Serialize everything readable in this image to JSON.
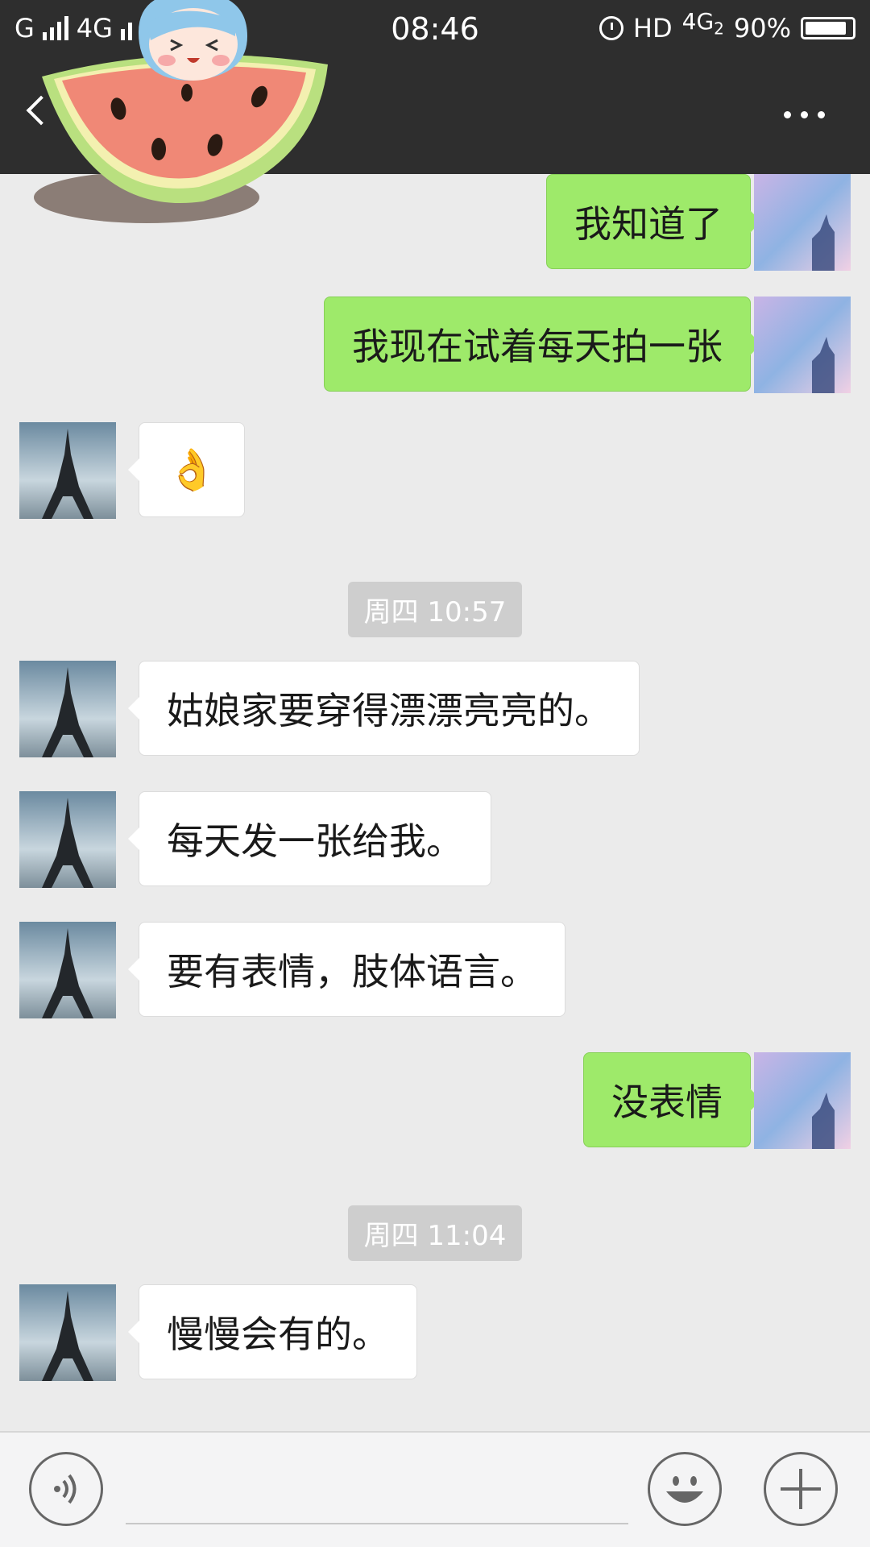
{
  "status_bar": {
    "carrier_left": "G",
    "network_2": "4G",
    "time": "08:46",
    "hd_label": "HD",
    "network_3": "4G",
    "network_3_sub": "2",
    "battery_text": "90%",
    "battery_level": 0.9
  },
  "header": {
    "back_icon": "chevron-left-icon",
    "more_icon": "more-dots-icon"
  },
  "sticker": {
    "description_icon": "watermelon-girl-sticker-icon"
  },
  "messages": [
    {
      "side": "right",
      "text": "我知道了"
    },
    {
      "side": "right",
      "text": "我现在试着每天拍一张"
    },
    {
      "side": "left",
      "text": "👌"
    },
    {
      "type": "timestamp",
      "text": "周四 10:57"
    },
    {
      "side": "left",
      "text": "姑娘家要穿得漂漂亮亮的。"
    },
    {
      "side": "left",
      "text": "每天发一张给我。"
    },
    {
      "side": "left",
      "text": "要有表情，肢体语言。"
    },
    {
      "side": "right",
      "text": "没表情"
    },
    {
      "type": "timestamp",
      "text": "周四 11:04"
    },
    {
      "side": "left",
      "text": "慢慢会有的。"
    }
  ],
  "input_bar": {
    "voice_icon": "voice-icon",
    "emoji_icon": "emoji-icon",
    "plus_icon": "plus-icon",
    "text_value": ""
  },
  "colors": {
    "header_bg": "#2e2e2e",
    "chat_bg": "#ebebeb",
    "sent_bubble": "#9eea6a",
    "received_bubble": "#ffffff"
  }
}
